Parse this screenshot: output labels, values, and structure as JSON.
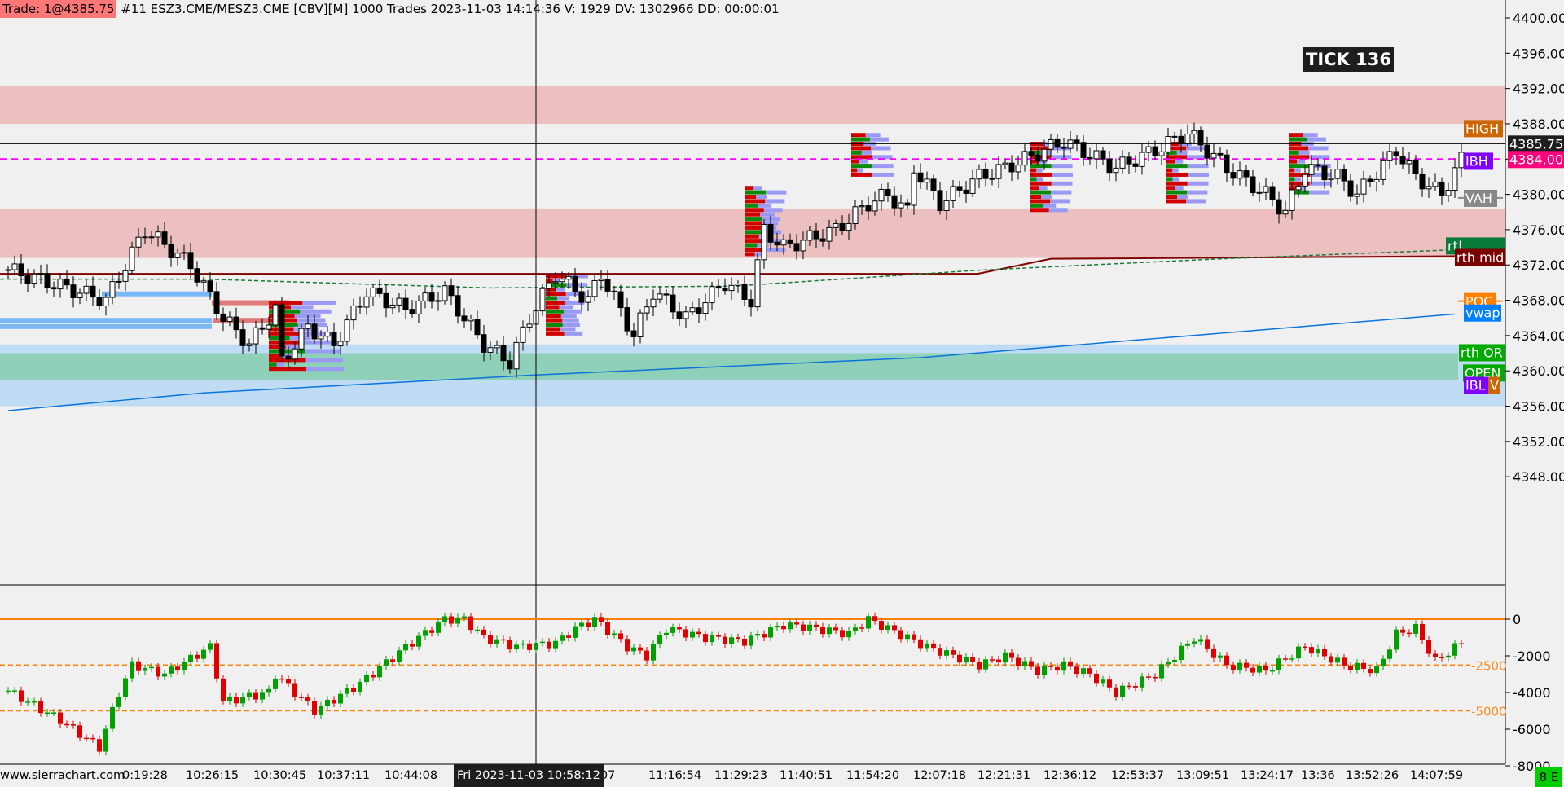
{
  "header": {
    "trade": "Trade: 1@4385.75",
    "info": "#11 ESZ3.CME/MESZ3.CME [CBV][M]  1000 Trades 2023-11-03 14:14:36 V: 1929 DV: 1302966 DD: 00:00:01"
  },
  "badge": "TICK 136",
  "site": "www.sierrachart.com",
  "status_box": "8 E",
  "time_axis": {
    "cursor_label": "Fri 2023-11-03  10:58:12",
    "labels": [
      "0:19:28",
      "10:26:15",
      "10:30:45",
      "10:37:11",
      "10:44:08",
      ":07",
      "11:16:54",
      "11:29:23",
      "11:40:51",
      "11:54:20",
      "12:07:18",
      "12:21:31",
      "12:36:12",
      "12:53:37",
      "13:09:51",
      "13:24:17",
      "13:36",
      "13:52:26",
      "14:07:59"
    ]
  },
  "price_axis": {
    "ticks": [
      "4400.00",
      "4396.00",
      "4392.00",
      "4388.00",
      "4384.00",
      "4380.00",
      "4376.00",
      "4372.00",
      "4368.00",
      "4364.00",
      "4360.00",
      "4356.00",
      "4352.00",
      "4348.00"
    ],
    "last_price": "4385.75",
    "ibh_price": "4384.00"
  },
  "level_labels": {
    "high": "HIGH",
    "ibh": "IBH",
    "vah": "VAH",
    "rth_hi": "rt|",
    "rth_mid": "rth mid",
    "poc": "POC",
    "vwap": "vwap",
    "rth_or": "rth OR",
    "open": "OPEN",
    "ibl": "IBL",
    "v": "V"
  },
  "colors": {
    "up": "#ffffff",
    "down": "#000000",
    "zone_red": "#ecc0c0",
    "zone_blue": "#c0dcf4",
    "zone_green": "#8fd0b8",
    "vwap": "#0a74da",
    "ibh": "#ff00ff",
    "rth_mid": "#800000",
    "accent_orange": "#ff8000"
  },
  "chart_data": [
    {
      "type": "candlestick",
      "name": "price",
      "ylim": [
        4345,
        4402
      ],
      "path": [
        [
          2,
          4371
        ],
        [
          15,
          4368
        ],
        [
          21,
          4376
        ],
        [
          28,
          4372
        ],
        [
          33,
          4366
        ],
        [
          37,
          4363
        ],
        [
          41,
          4367
        ],
        [
          42,
          4361
        ],
        [
          46,
          4365
        ],
        [
          50,
          4363
        ],
        [
          55,
          4369
        ],
        [
          61,
          4367
        ],
        [
          67,
          4369
        ],
        [
          73,
          4363
        ],
        [
          77,
          4361
        ],
        [
          80,
          4366
        ],
        [
          84,
          4371
        ],
        [
          89,
          4368
        ],
        [
          91,
          4371
        ],
        [
          96,
          4364
        ],
        [
          99,
          4369
        ],
        [
          104,
          4366
        ],
        [
          110,
          4370
        ],
        [
          114,
          4368
        ],
        [
          116,
          4376
        ],
        [
          119,
          4374
        ],
        [
          127,
          4376
        ],
        [
          132,
          4379
        ],
        [
          135,
          4380
        ],
        [
          138,
          4378
        ],
        [
          139,
          4383
        ],
        [
          143,
          4379
        ],
        [
          149,
          4382
        ],
        [
          153,
          4383
        ],
        [
          159,
          4385
        ],
        [
          162,
          4386
        ],
        [
          170,
          4383
        ],
        [
          176,
          4385
        ],
        [
          181,
          4387
        ],
        [
          187,
          4383
        ],
        [
          193,
          4380
        ],
        [
          196,
          4378
        ],
        [
          199,
          4383
        ],
        [
          204,
          4382
        ],
        [
          207,
          4380
        ],
        [
          213,
          4385
        ],
        [
          216,
          4382
        ],
        [
          220,
          4380
        ],
        [
          223,
          4384
        ]
      ],
      "vwap": [
        [
          0,
          4355.5
        ],
        [
          30,
          4357.5
        ],
        [
          80,
          4359.5
        ],
        [
          140,
          4361.5
        ],
        [
          190,
          4364.5
        ],
        [
          223,
          4366.5
        ]
      ]
    },
    {
      "type": "bar-candles",
      "name": "cumulative delta",
      "ylim": [
        -8000,
        1500
      ],
      "ticks": [
        "0",
        "-2000",
        "-4000",
        "-6000",
        "-8000"
      ],
      "ref_lines": [
        "-2500",
        "-5000"
      ],
      "path": [
        [
          2,
          -4300
        ],
        [
          8,
          -5500
        ],
        [
          14,
          -7000
        ],
        [
          17,
          -4000
        ],
        [
          19,
          -2500
        ],
        [
          24,
          -3000
        ],
        [
          31,
          -1500
        ],
        [
          33,
          -4500
        ],
        [
          40,
          -4000
        ],
        [
          41,
          -3000
        ],
        [
          47,
          -5000
        ],
        [
          54,
          -3500
        ],
        [
          61,
          -1500
        ],
        [
          67,
          0
        ],
        [
          70,
          0
        ],
        [
          73,
          -1000
        ],
        [
          78,
          -1500
        ],
        [
          84,
          -1300
        ],
        [
          87,
          -500
        ],
        [
          90,
          0
        ],
        [
          95,
          -1500
        ],
        [
          98,
          -2000
        ],
        [
          101,
          -500
        ],
        [
          107,
          -1000
        ],
        [
          113,
          -1200
        ],
        [
          119,
          -300
        ],
        [
          124,
          -500
        ],
        [
          129,
          -800
        ],
        [
          132,
          0
        ],
        [
          141,
          -1500
        ],
        [
          145,
          -2000
        ],
        [
          149,
          -2500
        ],
        [
          153,
          -2000
        ],
        [
          158,
          -2800
        ],
        [
          162,
          -2500
        ],
        [
          166,
          -3000
        ],
        [
          170,
          -4000
        ],
        [
          176,
          -3000
        ],
        [
          182,
          -1000
        ],
        [
          187,
          -2500
        ],
        [
          193,
          -2800
        ],
        [
          199,
          -1500
        ],
        [
          205,
          -2500
        ],
        [
          210,
          -2800
        ],
        [
          213,
          -800
        ],
        [
          216,
          -500
        ],
        [
          219,
          -2300
        ],
        [
          223,
          -1300
        ]
      ]
    }
  ]
}
